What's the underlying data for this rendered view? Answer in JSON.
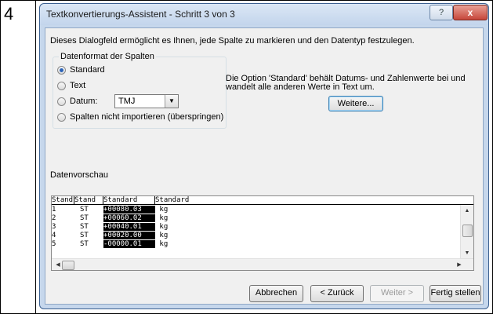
{
  "step_number": "4",
  "window": {
    "title": "Textkonvertierungs-Assistent - Schritt 3 von 3",
    "help_glyph": "?",
    "close_glyph": "x"
  },
  "intro_text": "Dieses Dialogfeld ermöglicht es Ihnen, jede Spalte zu markieren und den Datentyp festzulegen.",
  "column_format": {
    "group_title": "Datenformat der Spalten",
    "options": [
      {
        "label": "Standard",
        "checked": true
      },
      {
        "label": "Text",
        "checked": false
      },
      {
        "label": "Datum:",
        "checked": false
      },
      {
        "label": "Spalten nicht importieren (überspringen)",
        "checked": false
      }
    ],
    "date_format_value": "TMJ"
  },
  "info_text": "Die Option 'Standard' behält Datums- und Zahlenwerte bei und wandelt alle anderen Werte in Text um.",
  "more_button_label": "Weitere...",
  "preview": {
    "label": "Datenvorschau",
    "headers": [
      "Stand",
      "Stand",
      "Standard",
      "Standard"
    ],
    "rows": [
      [
        "1",
        "ST",
        "+00080.03",
        " kg"
      ],
      [
        "2",
        "ST",
        "+00060.02",
        " kg"
      ],
      [
        "3",
        "ST",
        "+00040.01",
        " kg"
      ],
      [
        "4",
        "ST",
        "+00020.00",
        " kg"
      ],
      [
        "5",
        "ST",
        "-00000.01",
        " kg"
      ]
    ]
  },
  "buttons": {
    "cancel": "Abbrechen",
    "back": "< Zurück",
    "next": "Weiter >",
    "finish": "Fertig stellen"
  },
  "colors": {
    "selected_column_bg": "#000000",
    "selected_column_text": "#ffffff",
    "radio_dot": "#2b63b8"
  }
}
